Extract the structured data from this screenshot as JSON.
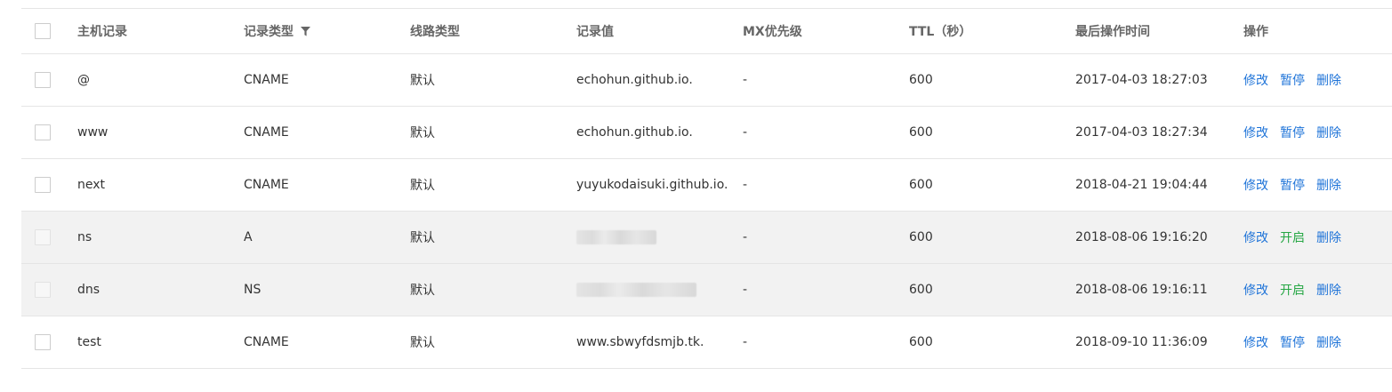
{
  "header": {
    "host": "主机记录",
    "type": "记录类型",
    "line": "线路类型",
    "value": "记录值",
    "mx": "MX优先级",
    "ttl": "TTL（秒）",
    "time": "最后操作时间",
    "ops": "操作"
  },
  "rows": [
    {
      "host": "@",
      "type": "CNAME",
      "line": "默认",
      "value": "echohun.github.io.",
      "mx": "-",
      "ttl": "600",
      "time": "2017-04-03 18:27:03",
      "op1": "修改",
      "op2": "暂停",
      "op3": "删除"
    },
    {
      "host": "www",
      "type": "CNAME",
      "line": "默认",
      "value": "echohun.github.io.",
      "mx": "-",
      "ttl": "600",
      "time": "2017-04-03 18:27:34",
      "op1": "修改",
      "op2": "暂停",
      "op3": "删除"
    },
    {
      "host": "next",
      "type": "CNAME",
      "line": "默认",
      "value": "yuyukodaisuki.github.io.",
      "mx": "-",
      "ttl": "600",
      "time": "2018-04-21 19:04:44",
      "op1": "修改",
      "op2": "暂停",
      "op3": "删除"
    },
    {
      "host": "ns",
      "type": "A",
      "line": "默认",
      "value": "",
      "mx": "-",
      "ttl": "600",
      "time": "2018-08-06 19:16:20",
      "op1": "修改",
      "op2": "开启",
      "op3": "删除"
    },
    {
      "host": "dns",
      "type": "NS",
      "line": "默认",
      "value": "",
      "mx": "-",
      "ttl": "600",
      "time": "2018-08-06 19:16:11",
      "op1": "修改",
      "op2": "开启",
      "op3": "删除"
    },
    {
      "host": "test",
      "type": "CNAME",
      "line": "默认",
      "value": "www.sbwyfdsmjb.tk.",
      "mx": "-",
      "ttl": "600",
      "time": "2018-09-10 11:36:09",
      "op1": "修改",
      "op2": "暂停",
      "op3": "删除"
    }
  ],
  "colors": {
    "link": "#1e73d8",
    "enable": "#27a745",
    "paused_row_bg": "#f2f2f2",
    "border": "#e5e5e5"
  },
  "icons": {
    "filter": "filter-icon",
    "redacted": "redacted-value"
  }
}
